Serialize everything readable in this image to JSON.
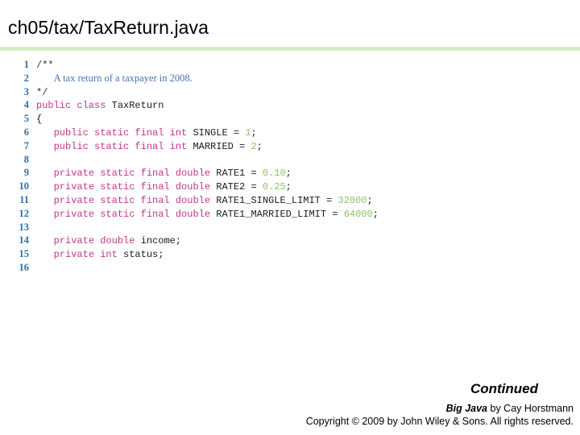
{
  "slide": {
    "title": "ch05/tax/TaxReturn.java",
    "rule_color": "#d6ecc2",
    "background_color": "#ffffff"
  },
  "syntax_colors": {
    "keyword": "#c2368c",
    "comment": "#4a6fb5",
    "comment_delimiter": "#2b2b2b",
    "number": "#8dc367",
    "identifier": "#1a1a1a",
    "line_number": "#3170a8"
  },
  "code": {
    "language": "java",
    "lines": [
      {
        "n": "1",
        "tokens": [
          {
            "t": "/**",
            "c": "cdelim"
          }
        ]
      },
      {
        "n": "2",
        "tokens": [
          {
            "t": "   ",
            "c": "punct"
          },
          {
            "t": "A tax return of a taxpayer in 2008.",
            "c": "comment"
          }
        ]
      },
      {
        "n": "3",
        "tokens": [
          {
            "t": "*/",
            "c": "cdelim"
          }
        ]
      },
      {
        "n": "4",
        "tokens": [
          {
            "t": "public class ",
            "c": "kw"
          },
          {
            "t": "TaxReturn",
            "c": "id"
          }
        ]
      },
      {
        "n": "5",
        "tokens": [
          {
            "t": "{",
            "c": "punct"
          }
        ]
      },
      {
        "n": "6",
        "tokens": [
          {
            "t": "   ",
            "c": "punct"
          },
          {
            "t": "public static final int ",
            "c": "kw"
          },
          {
            "t": "SINGLE = ",
            "c": "id"
          },
          {
            "t": "1",
            "c": "num"
          },
          {
            "t": ";",
            "c": "punct"
          }
        ]
      },
      {
        "n": "7",
        "tokens": [
          {
            "t": "   ",
            "c": "punct"
          },
          {
            "t": "public static final int ",
            "c": "kw"
          },
          {
            "t": "MARRIED = ",
            "c": "id"
          },
          {
            "t": "2",
            "c": "num"
          },
          {
            "t": ";",
            "c": "punct"
          }
        ]
      },
      {
        "n": "8",
        "tokens": []
      },
      {
        "n": "9",
        "tokens": [
          {
            "t": "   ",
            "c": "punct"
          },
          {
            "t": "private static final double ",
            "c": "kw"
          },
          {
            "t": "RATE1 = ",
            "c": "id"
          },
          {
            "t": "0.10",
            "c": "num"
          },
          {
            "t": ";",
            "c": "punct"
          }
        ]
      },
      {
        "n": "10",
        "tokens": [
          {
            "t": "   ",
            "c": "punct"
          },
          {
            "t": "private static final double ",
            "c": "kw"
          },
          {
            "t": "RATE2 = ",
            "c": "id"
          },
          {
            "t": "0.25",
            "c": "num"
          },
          {
            "t": ";",
            "c": "punct"
          }
        ]
      },
      {
        "n": "11",
        "tokens": [
          {
            "t": "   ",
            "c": "punct"
          },
          {
            "t": "private static final double ",
            "c": "kw"
          },
          {
            "t": "RATE1_SINGLE_LIMIT = ",
            "c": "id"
          },
          {
            "t": "32000",
            "c": "num"
          },
          {
            "t": ";",
            "c": "punct"
          }
        ]
      },
      {
        "n": "12",
        "tokens": [
          {
            "t": "   ",
            "c": "punct"
          },
          {
            "t": "private static final double ",
            "c": "kw"
          },
          {
            "t": "RATE1_MARRIED_LIMIT = ",
            "c": "id"
          },
          {
            "t": "64000",
            "c": "num"
          },
          {
            "t": ";",
            "c": "punct"
          }
        ]
      },
      {
        "n": "13",
        "tokens": []
      },
      {
        "n": "14",
        "tokens": [
          {
            "t": "   ",
            "c": "punct"
          },
          {
            "t": "private double ",
            "c": "kw"
          },
          {
            "t": "income",
            "c": "id"
          },
          {
            "t": ";",
            "c": "punct"
          }
        ]
      },
      {
        "n": "15",
        "tokens": [
          {
            "t": "   ",
            "c": "punct"
          },
          {
            "t": "private int ",
            "c": "kw"
          },
          {
            "t": "status",
            "c": "id"
          },
          {
            "t": ";",
            "c": "punct"
          }
        ]
      },
      {
        "n": "16",
        "tokens": []
      }
    ]
  },
  "footer": {
    "continued_label": "Continued",
    "book_title": "Big Java",
    "byline": " by Cay Horstmann",
    "copyright": "Copyright © 2009 by John Wiley & Sons.  All rights reserved."
  }
}
